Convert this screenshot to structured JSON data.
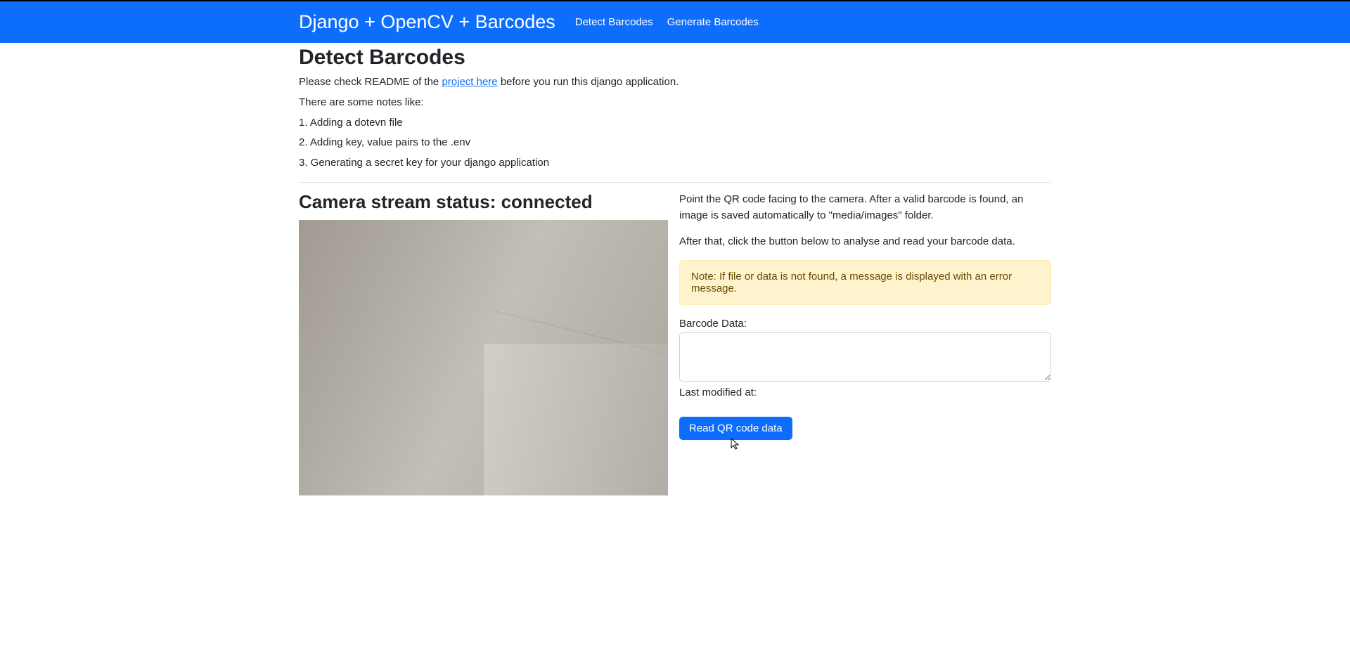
{
  "navbar": {
    "brand": "Django + OpenCV + Barcodes",
    "links": [
      {
        "label": "Detect Barcodes"
      },
      {
        "label": "Generate Barcodes"
      }
    ]
  },
  "page": {
    "title": "Detect Barcodes",
    "intro_prefix": "Please check README of the ",
    "intro_link": "project here",
    "intro_suffix": " before you run this django application.",
    "notes_heading": "There are some notes like:",
    "notes": [
      "1. Adding a dotevn file",
      "2. Adding key, value pairs to the .env",
      "3. Generating a secret key for your django application"
    ]
  },
  "stream": {
    "status_label": "Camera stream status: ",
    "status_value": "connected"
  },
  "right": {
    "p1": "Point the QR code facing to the camera. After a valid barcode is found, an image is saved automatically to \"media/images\" folder.",
    "p2": "After that, click the button below to analyse and read your barcode data.",
    "note": "Note: If file or data is not found, a message is displayed with an error message.",
    "barcode_label": "Barcode Data:",
    "barcode_value": "",
    "last_modified_label": "Last modified at:",
    "button_label": "Read QR code data"
  }
}
